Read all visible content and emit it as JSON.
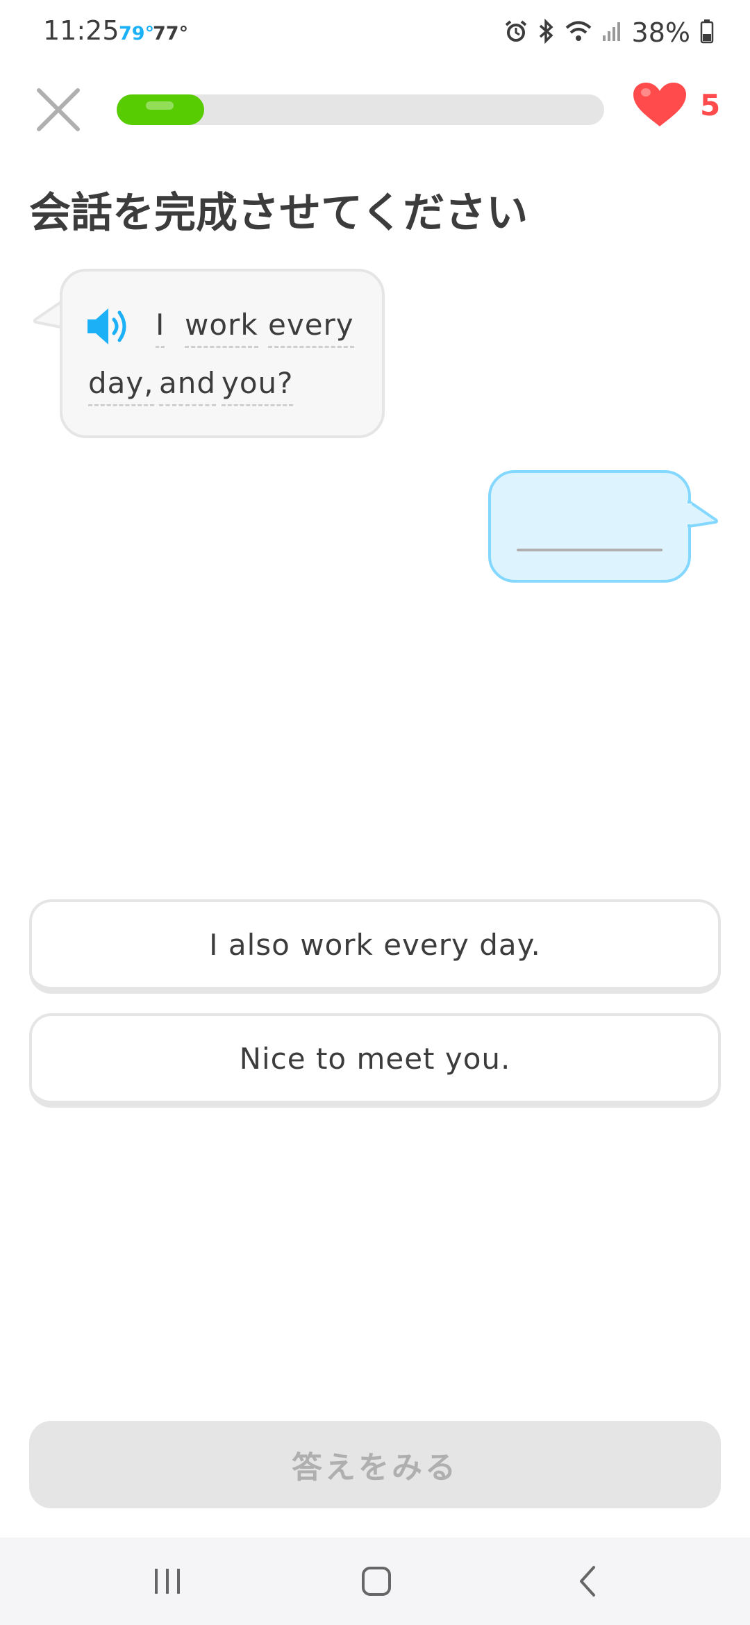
{
  "status_bar": {
    "time": "11:25",
    "temp_current": "79°",
    "temp_other": "77°",
    "battery": "38%",
    "icons": [
      "alarm-icon",
      "bluetooth-icon",
      "wifi-icon",
      "signal-icon",
      "battery-icon"
    ]
  },
  "header": {
    "progress_fraction": 0.18,
    "hearts_count": "5",
    "colors": {
      "progress": "#58cc02",
      "heart": "#ff4b4b"
    }
  },
  "title": "会話を完成させてください",
  "prompt": {
    "words": [
      "I",
      "work",
      "every",
      "day,",
      "and",
      "you?"
    ]
  },
  "choices": [
    {
      "label": "I also work every day."
    },
    {
      "label": "Nice to meet you."
    }
  ],
  "check_button": {
    "label": "答えをみる"
  },
  "nav": [
    "recents-icon",
    "home-icon",
    "back-icon"
  ]
}
